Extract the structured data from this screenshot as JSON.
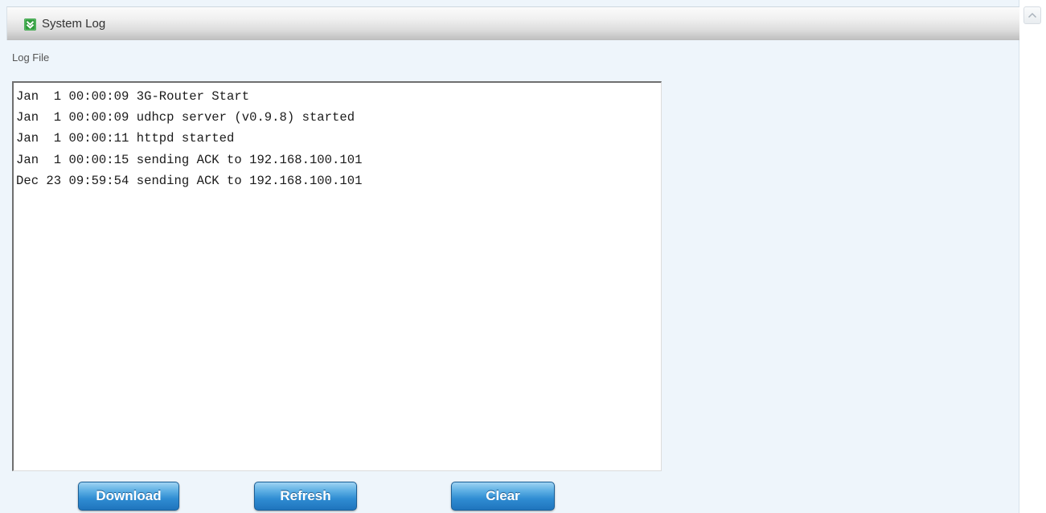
{
  "header": {
    "title": "System Log",
    "icon": "green-check-icon",
    "icon_color": "#2e9b3b"
  },
  "log": {
    "label": "Log File",
    "content": "Jan  1 00:00:09 3G-Router Start\nJan  1 00:00:09 udhcp server (v0.9.8) started\nJan  1 00:00:11 httpd started\nJan  1 00:00:15 sending ACK to 192.168.100.101\nDec 23 09:59:54 sending ACK to 192.168.100.101"
  },
  "buttons": {
    "download": "Download",
    "refresh": "Refresh",
    "clear": "Clear"
  },
  "colors": {
    "button_blue": "#2f8cd2",
    "page_background": "#eef5fb"
  },
  "scrollbar": {
    "up_icon": "chevron-up-icon"
  }
}
